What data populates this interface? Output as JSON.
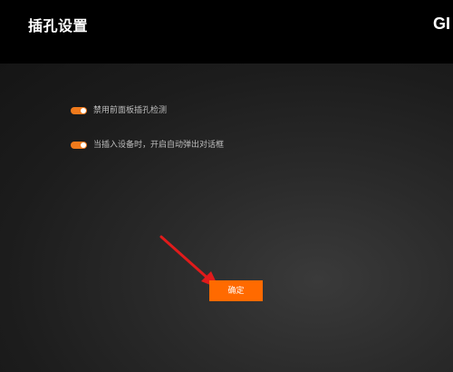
{
  "window": {
    "title": "插孔设置",
    "brand": "GI"
  },
  "options": [
    {
      "label": "禁用前面板插孔检测",
      "enabled": true
    },
    {
      "label": "当插入设备时，开启自动弹出对话框",
      "enabled": true
    }
  ],
  "actions": {
    "confirm_label": "确定"
  },
  "colors": {
    "accent": "#ff6a00",
    "toggle_on": "#f07a1c",
    "annotation_arrow": "#e01b1b"
  },
  "icons": {
    "annotation": "red-arrow-icon"
  }
}
